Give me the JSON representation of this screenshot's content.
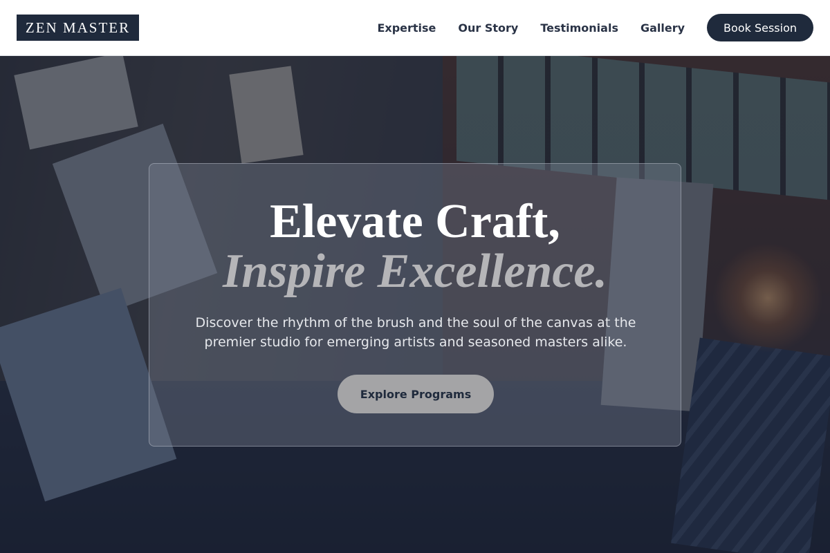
{
  "header": {
    "logo": "ZEN MASTER",
    "nav": [
      {
        "label": "Expertise"
      },
      {
        "label": "Our Story"
      },
      {
        "label": "Testimonials"
      },
      {
        "label": "Gallery"
      }
    ],
    "cta_label": "Book Session"
  },
  "hero": {
    "title_line1": "Elevate Craft,",
    "title_line2": "Inspire Excellence.",
    "subtitle": "Discover the rhythm of the brush and the soul of the canvas at the premier studio for emerging artists and seasoned masters alike.",
    "cta_label": "Explore Programs",
    "background_image": "art-studio-photo"
  },
  "colors": {
    "brand_navy": "#1f2a3c",
    "header_bg": "#ffffff",
    "cta_gray": "#a4a4a6",
    "title_white": "#ffffff",
    "title_italic_gray": "#b5b5b8"
  }
}
